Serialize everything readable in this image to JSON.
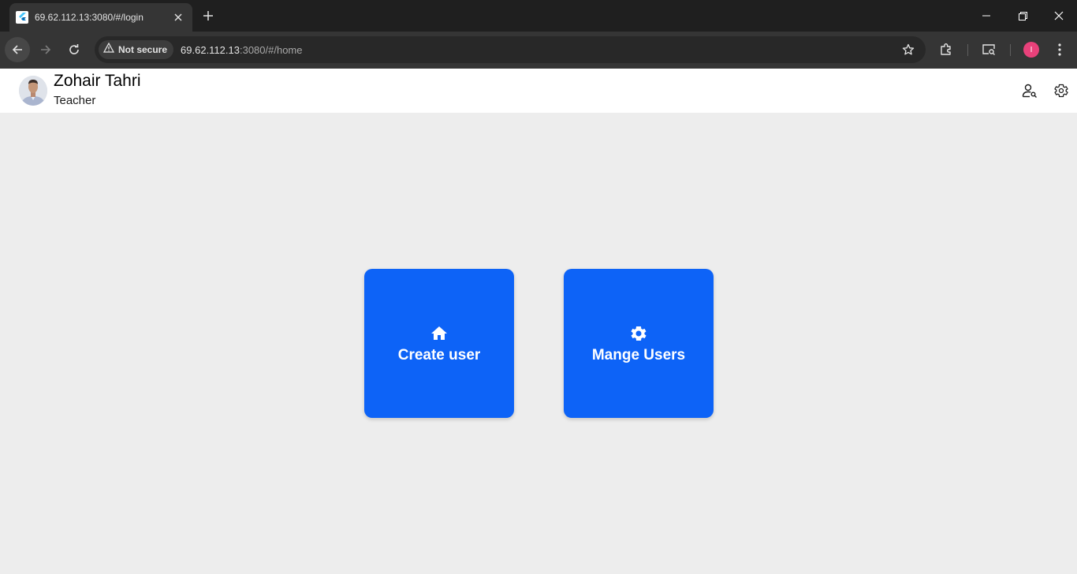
{
  "browser": {
    "tab": {
      "title": "69.62.112.13:3080/#/login"
    },
    "security_label": "Not secure",
    "url_host": "69.62.112.13",
    "url_path": ":3080/#/home",
    "profile_initial": "I"
  },
  "header": {
    "name": "Zohair Tahri",
    "role": "Teacher"
  },
  "tiles": [
    {
      "label": "Create user",
      "icon": "home-icon"
    },
    {
      "label": "Mange Users",
      "icon": "gear-icon"
    }
  ],
  "colors": {
    "tile_blue": "#0d63f7",
    "page_background": "#ededed",
    "profile_pink": "#e8417a"
  }
}
